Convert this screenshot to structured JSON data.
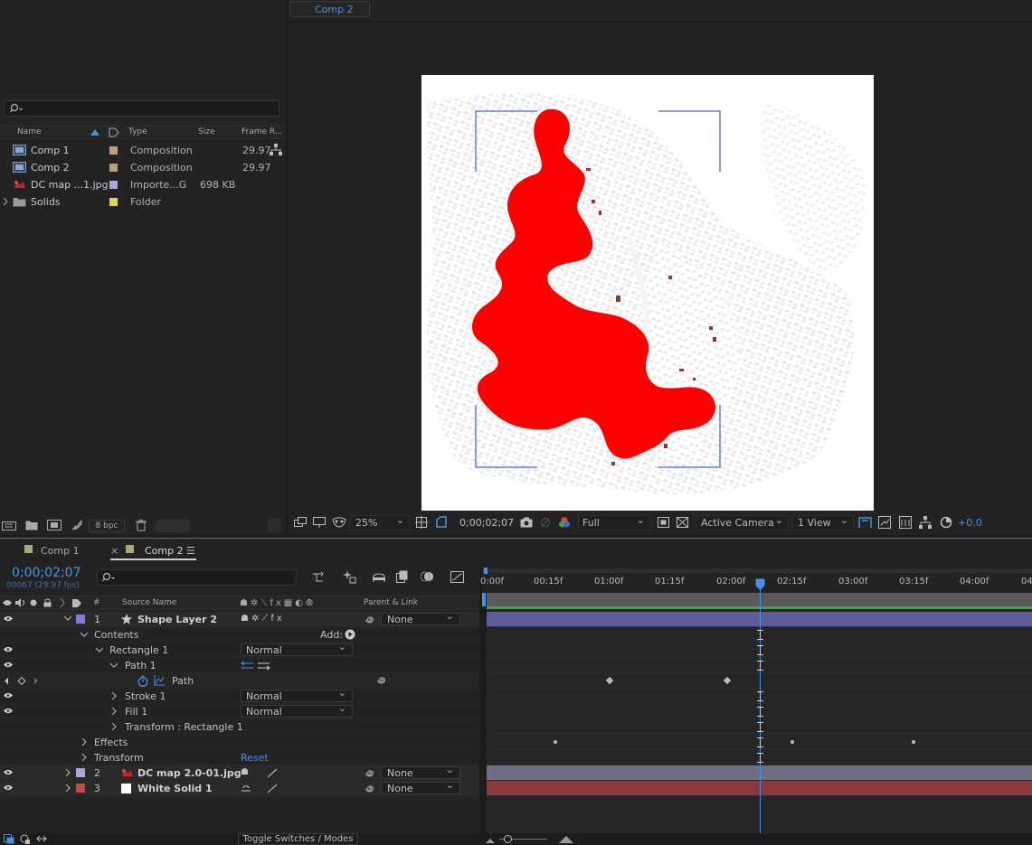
{
  "project": {
    "columns": {
      "name": "Name",
      "type": "Type",
      "size": "Size",
      "frame_rate": "Frame R..."
    },
    "items": [
      {
        "name": "Comp 1",
        "type": "Composition",
        "size": "",
        "fps": "29.97",
        "icon": "composition-icon",
        "label_color": "#b5a27a"
      },
      {
        "name": "Comp 2",
        "type": "Composition",
        "size": "",
        "fps": "29.97",
        "icon": "composition-icon",
        "label_color": "#b5a27a"
      },
      {
        "name": "DC map ...1.jpg",
        "type": "Importe...G",
        "size": "698 KB",
        "fps": "",
        "icon": "image-file-icon",
        "label_color": "#a9a9d6"
      },
      {
        "name": "Solids",
        "type": "Folder",
        "size": "",
        "fps": "",
        "icon": "folder-icon",
        "label_color": "#e3d44a"
      }
    ],
    "footer": {
      "bpc": "8 bpc"
    }
  },
  "viewer": {
    "tab": "Comp 2",
    "zoom": "25%",
    "timecode": "0;00;02;07",
    "resolution": "Full",
    "camera": "Active Camera",
    "views": "1 View",
    "exposure": "+0.0"
  },
  "timeline": {
    "tabs": [
      {
        "label": "Comp 1",
        "color": "#b5a27a"
      },
      {
        "label": "Comp 2",
        "color": "#b5a27a"
      }
    ],
    "current_time": "0;00;02;07",
    "frame_info": "00067 (29.97 fps)",
    "columns": {
      "num": "#",
      "source_name": "Source Name",
      "parent": "Parent & Link"
    },
    "ruler": [
      "0:00f",
      "00:15f",
      "01:00f",
      "01:15f",
      "02:00f",
      "02:15f",
      "03:00f",
      "03:15f",
      "04:00f",
      "04"
    ],
    "layers": {
      "l1": {
        "num": "1",
        "name": "Shape Layer 2",
        "parent": "None",
        "label_color": "#7b7fd6"
      },
      "contents": "Contents",
      "add": "Add:",
      "rect": {
        "name": "Rectangle 1",
        "mode": "Normal"
      },
      "path1": "Path 1",
      "path": "Path",
      "stroke": {
        "name": "Stroke 1",
        "mode": "Normal"
      },
      "fill": {
        "name": "Fill 1",
        "mode": "Normal"
      },
      "transform_rect": "Transform : Rectangle 1",
      "effects": "Effects",
      "transform": "Transform",
      "reset": "Reset",
      "l2": {
        "num": "2",
        "name": "DC map 2.0-01.jpg",
        "parent": "None",
        "label_color": "#a9a9d6"
      },
      "l3": {
        "num": "3",
        "name": "White Solid 1",
        "parent": "None",
        "label_color": "#c94848"
      }
    },
    "toggle_label": "Toggle Switches / Modes"
  },
  "colors": {
    "accent": "#4a90e2",
    "shape_fill": "#ff0000",
    "track_shape": "#5c5e9c",
    "track_map": "#6e6e86",
    "track_solid": "#8a3a3e"
  }
}
